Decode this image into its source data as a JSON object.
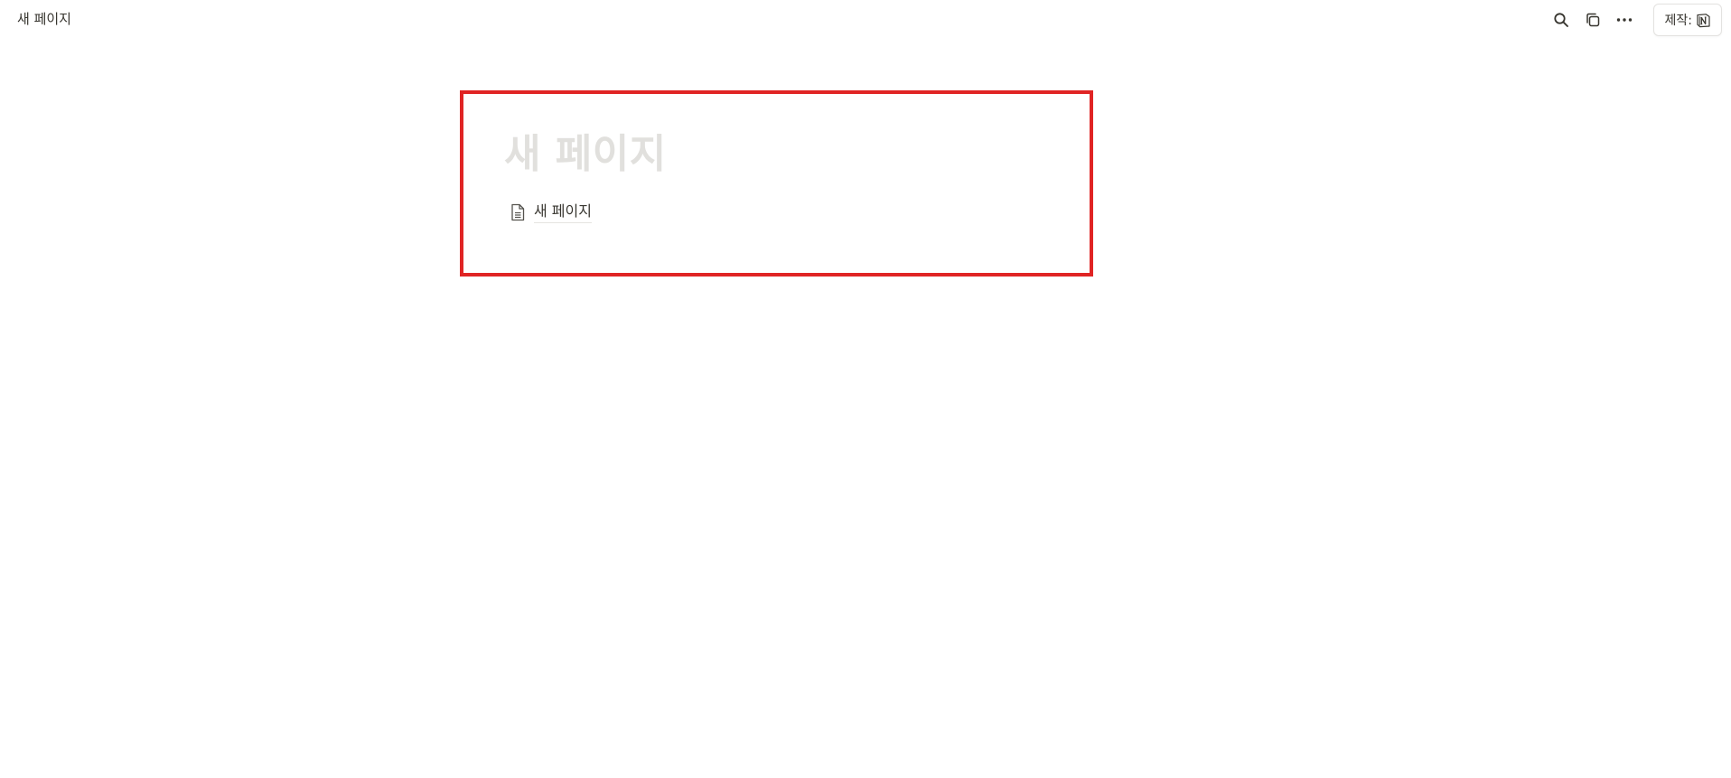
{
  "topbar": {
    "breadcrumb_title": "새 페이지",
    "made_with_label": "제작:"
  },
  "icons": {
    "search": "search-icon",
    "duplicate": "duplicate-icon",
    "more": "more-horizontal-icon",
    "notion_logo": "notion-logo-icon",
    "document": "document-icon"
  },
  "page": {
    "title": "새 페이지",
    "subpage_link_label": "새 페이지"
  },
  "colors": {
    "highlight_border": "#e02424",
    "title_placeholder": "#e1e0dd",
    "text": "#37352f"
  }
}
